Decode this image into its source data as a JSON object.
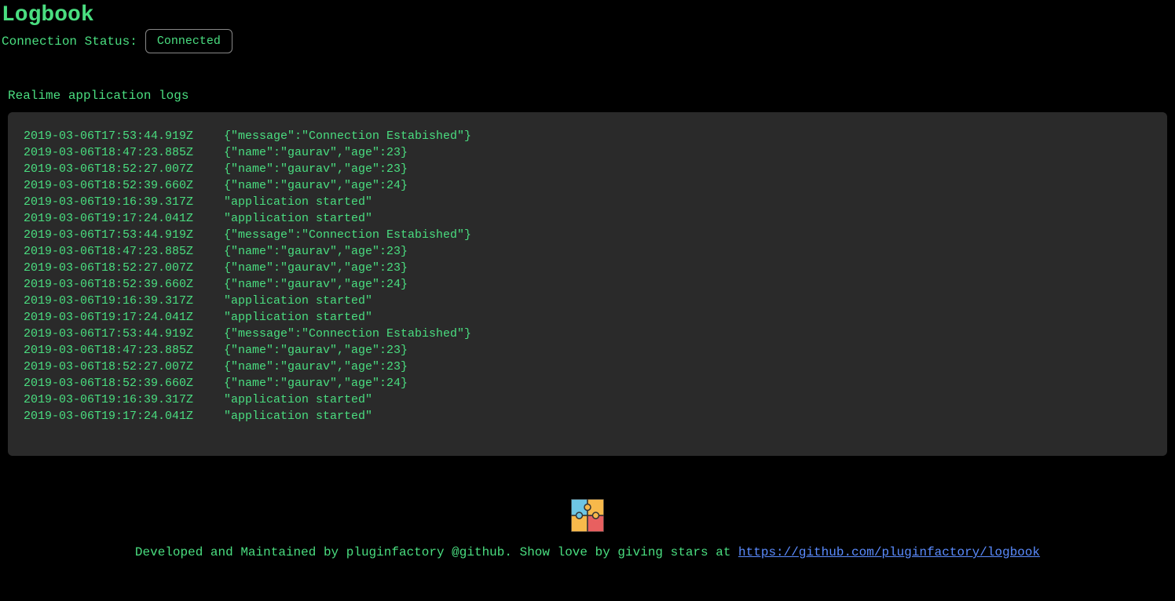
{
  "header": {
    "title": "Logbook",
    "status_label": "Connection Status:",
    "status_value": "Connected"
  },
  "logs": {
    "section_title": "Realime application logs",
    "entries": [
      {
        "timestamp": "2019-03-06T17:53:44.919Z",
        "payload": "{\"message\":\"Connection Estabished\"}"
      },
      {
        "timestamp": "2019-03-06T18:47:23.885Z",
        "payload": "{\"name\":\"gaurav\",\"age\":23}"
      },
      {
        "timestamp": "2019-03-06T18:52:27.007Z",
        "payload": "{\"name\":\"gaurav\",\"age\":23}"
      },
      {
        "timestamp": "2019-03-06T18:52:39.660Z",
        "payload": "{\"name\":\"gaurav\",\"age\":24}"
      },
      {
        "timestamp": "2019-03-06T19:16:39.317Z",
        "payload": "\"application started\""
      },
      {
        "timestamp": "2019-03-06T19:17:24.041Z",
        "payload": "\"application started\""
      },
      {
        "timestamp": "2019-03-06T17:53:44.919Z",
        "payload": "{\"message\":\"Connection Estabished\"}"
      },
      {
        "timestamp": "2019-03-06T18:47:23.885Z",
        "payload": "{\"name\":\"gaurav\",\"age\":23}"
      },
      {
        "timestamp": "2019-03-06T18:52:27.007Z",
        "payload": "{\"name\":\"gaurav\",\"age\":23}"
      },
      {
        "timestamp": "2019-03-06T18:52:39.660Z",
        "payload": "{\"name\":\"gaurav\",\"age\":24}"
      },
      {
        "timestamp": "2019-03-06T19:16:39.317Z",
        "payload": "\"application started\""
      },
      {
        "timestamp": "2019-03-06T19:17:24.041Z",
        "payload": "\"application started\""
      },
      {
        "timestamp": "2019-03-06T17:53:44.919Z",
        "payload": "{\"message\":\"Connection Estabished\"}"
      },
      {
        "timestamp": "2019-03-06T18:47:23.885Z",
        "payload": "{\"name\":\"gaurav\",\"age\":23}"
      },
      {
        "timestamp": "2019-03-06T18:52:27.007Z",
        "payload": "{\"name\":\"gaurav\",\"age\":23}"
      },
      {
        "timestamp": "2019-03-06T18:52:39.660Z",
        "payload": "{\"name\":\"gaurav\",\"age\":24}"
      },
      {
        "timestamp": "2019-03-06T19:16:39.317Z",
        "payload": "\"application started\""
      },
      {
        "timestamp": "2019-03-06T19:17:24.041Z",
        "payload": "\"application started\""
      }
    ]
  },
  "footer": {
    "text_before": "Developed and Maintained by pluginfactory @github. Show love by giving stars at ",
    "link_text": "https://github.com/pluginfactory/logbook",
    "link_href": "https://github.com/pluginfactory/logbook"
  }
}
